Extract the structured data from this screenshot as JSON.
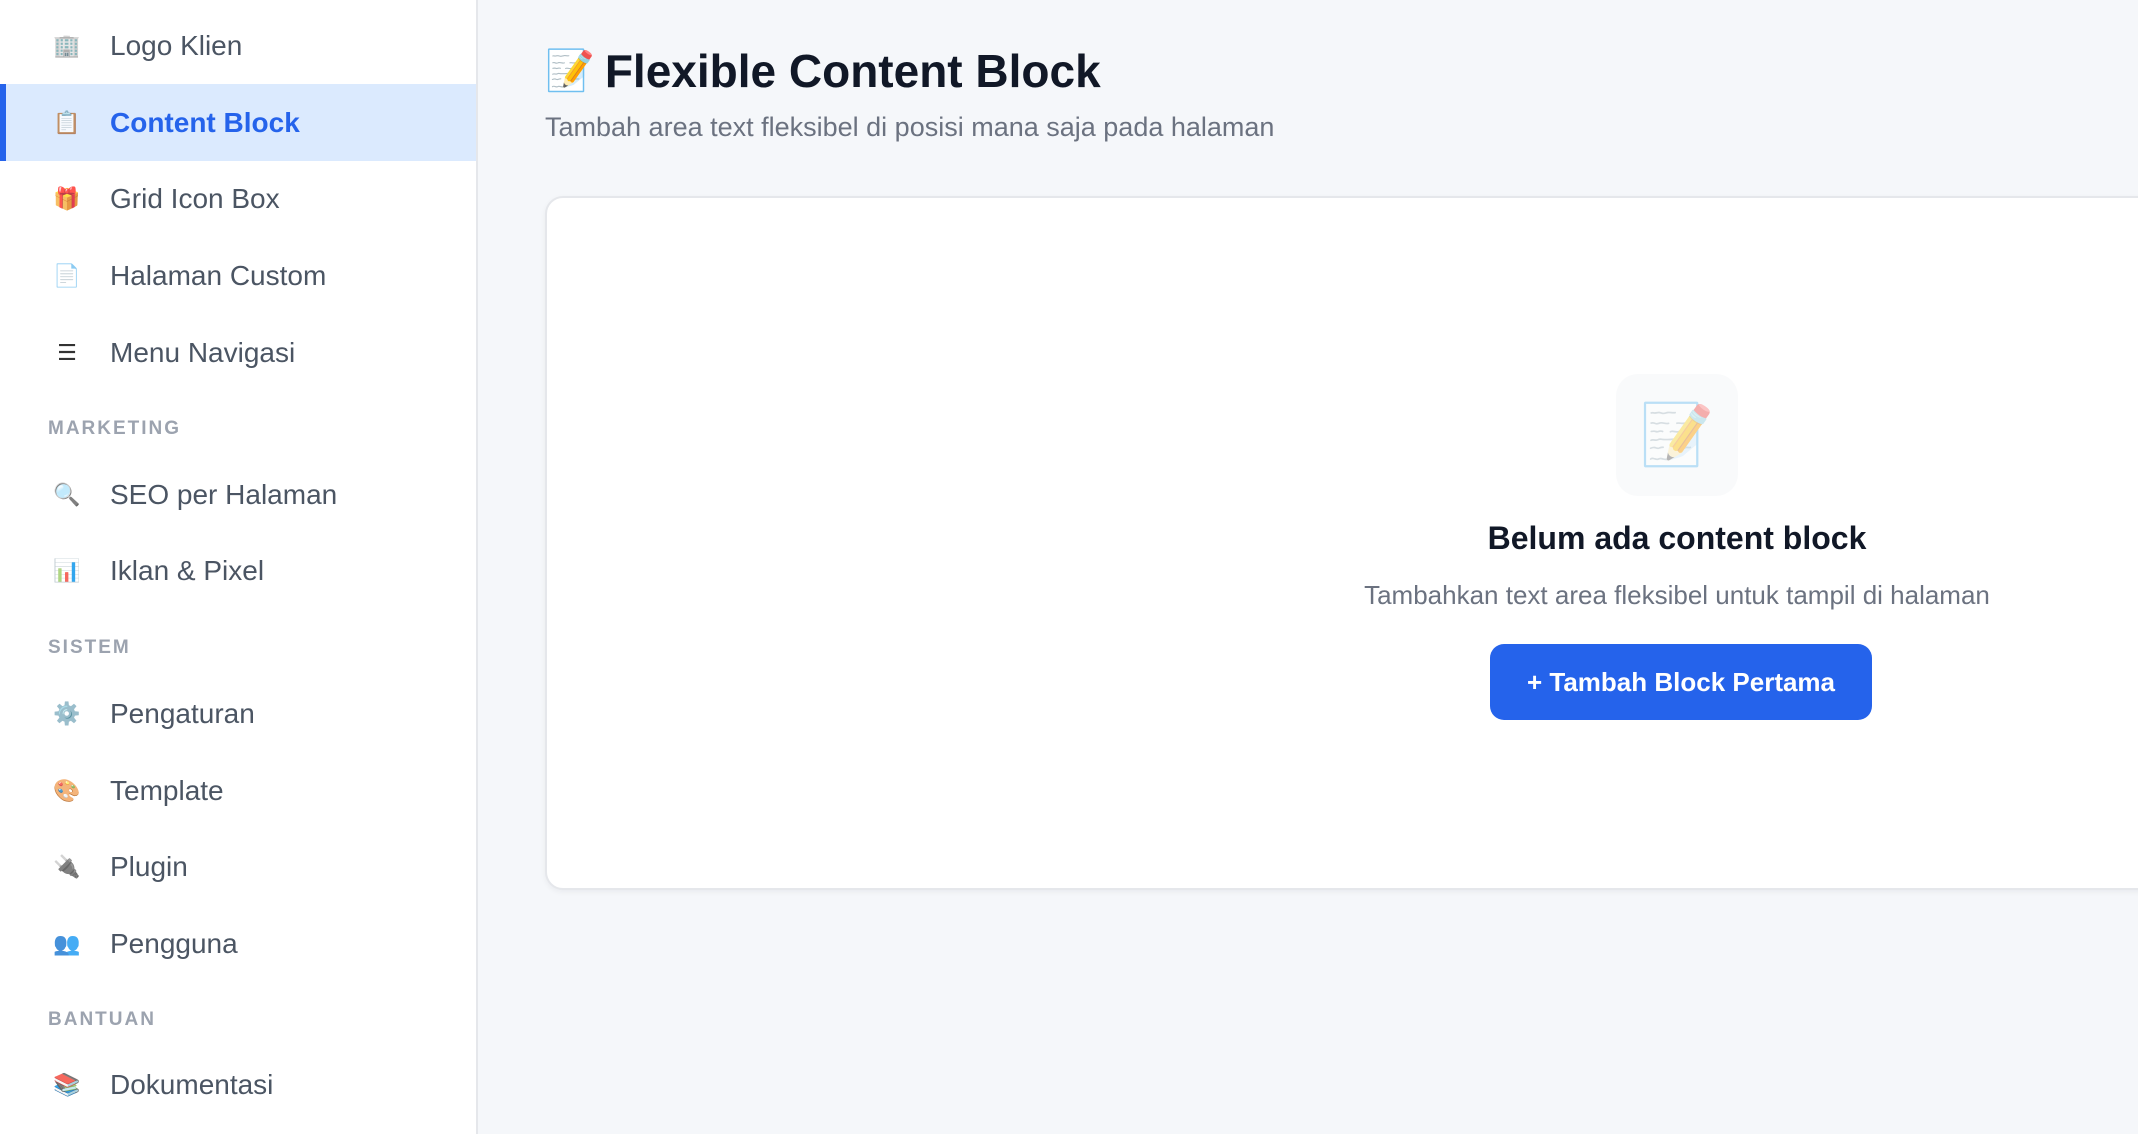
{
  "sidebar": {
    "items": [
      {
        "label": "Logo Klien",
        "icon": "building-icon",
        "glyph": "🏢"
      },
      {
        "label": "Content Block",
        "icon": "notepad-icon",
        "glyph": "📋",
        "active": true
      },
      {
        "label": "Grid Icon Box",
        "icon": "gift-icon",
        "glyph": "🎁"
      },
      {
        "label": "Halaman Custom",
        "icon": "page-icon",
        "glyph": "📄"
      },
      {
        "label": "Menu Navigasi",
        "icon": "menu-lines-icon",
        "glyph": "☰"
      }
    ],
    "sections": [
      {
        "title": "MARKETING",
        "items": [
          {
            "label": "SEO per Halaman",
            "icon": "magnifier-icon",
            "glyph": "🔍"
          },
          {
            "label": "Iklan & Pixel",
            "icon": "bar-chart-icon",
            "glyph": "📊"
          }
        ]
      },
      {
        "title": "SISTEM",
        "items": [
          {
            "label": "Pengaturan",
            "icon": "gear-icon",
            "glyph": "⚙️"
          },
          {
            "label": "Template",
            "icon": "palette-icon",
            "glyph": "🎨"
          },
          {
            "label": "Plugin",
            "icon": "plug-icon",
            "glyph": "🔌"
          },
          {
            "label": "Pengguna",
            "icon": "users-icon",
            "glyph": "👥"
          }
        ]
      },
      {
        "title": "BANTUAN",
        "items": [
          {
            "label": "Dokumentasi",
            "icon": "books-icon",
            "glyph": "📚"
          }
        ]
      }
    ]
  },
  "main": {
    "title": "Flexible Content Block",
    "title_glyph": "📝",
    "subtitle": "Tambah area text fleksibel di posisi mana saja pada halaman",
    "empty_state": {
      "glyph": "📝",
      "title": "Belum ada content block",
      "description": "Tambahkan text area fleksibel untuk tampil di halaman",
      "button_label": "+ Tambah Block Pertama"
    }
  },
  "colors": {
    "accent": "#2563eb",
    "active_bg": "#dbeafe",
    "page_bg": "#f5f7fa"
  }
}
